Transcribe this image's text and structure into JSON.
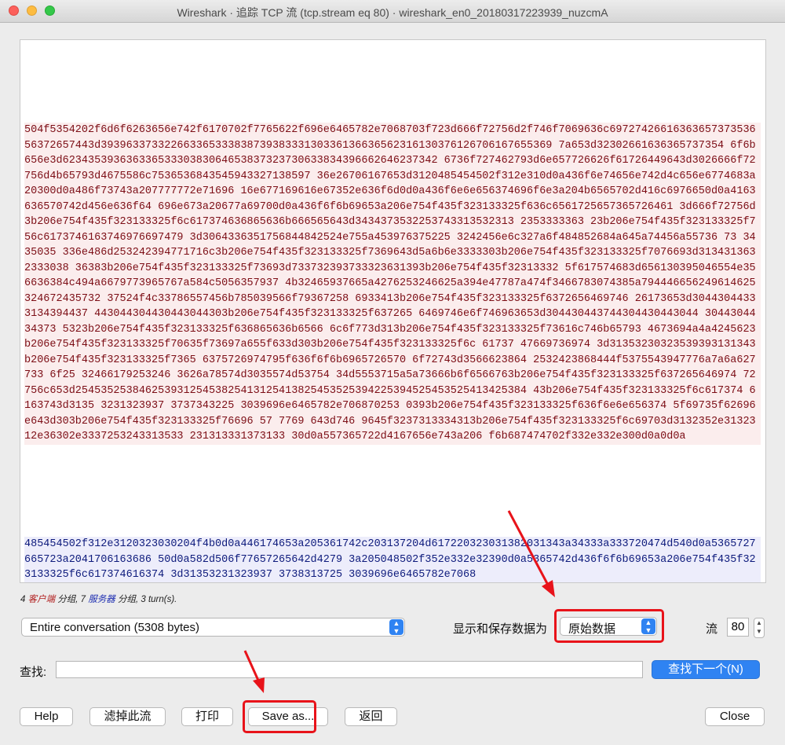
{
  "window": {
    "title": "Wireshark · 追踪 TCP 流 (tcp.stream eq 80) · wireshark_en0_20180317223939_nuzcmA"
  },
  "stream": {
    "client_text": "504f5354202f6d6f6263656e742f6170702f7765622f696e6465782e7068703f723d666f72756d2f746f7069636c6972742661636365737353656372657443d39396337332266336533383873938333130336136636562316130376126706167655369 7a653d32302661636365737354 6f6b656e3d62343539363633653330383064653837323730633834396662646237342 6736f727462793d6e657726626f61726449643d3026666f72756d4b65793d4675586c7536536843545943327138597 36e26706167653d3120485454502f312e310d0a436f6e74656e742d4c656e6774683a20300d0a486f73743a207777772e71696 16e677169616e67352e636f6d0d0a436f6e6e656374696f6e3a204b6565702d416c6976650d0a4163636570742d456e636f64 696e673a20677a69700d0a436f6f6b69653a206e754f435f323133325f636c6561725657365726461 3d666f72756d3b206e754f435f323133325f6c617374636865636b666565643d3434373532253743313532313 2353333363 23b206e754f435f323133325f756c6173746163746976697479 3d3064336351756844842524e755a453976375225 3242456e6c327a6f484852684a645a74456a55736 73 3435035 336e486d253242394771716c3b206e754f435f323133325f7369643d5a6b6e3333303b206e754f435f323133325f7076693d3134313632333038 36383b206e754f435f323133325f73693d733732393733323631393b206e754f435f32313332 5f617574683d656130395046554e356636384c494a6679773965767a584c5056357937 4b32465937665a4276253246625a394e47787a474f3466783074385a794446656249614625324672435732 37524f4c33786557456b785039566f79367258 6933413b206e754f435f323133325f6372656469746 26173653d30443044333134394437 443044304430443044303b206e754f435f323133325f637265 6469746e6f746963653d304430443744304430443044 3044304434373 5323b206e754f435f323133325f636865636b6566 6c6f773d313b206e754f435f323133325f73616c746b65793 4673694a4a4245623b206e754f435f323133325f70635f73697a655f633d303b206e754f435f323133325f6c 61737 47669736974 3d31353230323539393131343b206e754f435f323133325f7365 6375726974795f636f6f6b6965726570 6f72743d3566623864 2532423868444f5375543947776a7a6a627733 6f25 32466179253246 3626a78574d3035574d53754 34d5553715a5a73666b6f6566763b206e754f435f323133325f637265646974 72756c653d25453525384625393125453825413125413825453525394225394525453525413425384 43b206e754f435f323133325f6c617374 6163743d3135 3231323937 3737343225 3039696e6465782e706870253 0393b206e754f435f323133325f636f6e6e656374 5f69735f62696e643d303b206e754f435f323133325f76696 57 7769 643d746 9645f3237313334313b206e754f435f323133325f6c69703d3132352e3132312e36302e3337253243313533 231313331373133 30d0a557365722d4167656e743a206 f6b687474702f332e332e300d0a0d0a",
    "server_text": "485454502f312e3120323030204f4b0d0a446174653a205361742c203137204d617220323031382031343a34333a333720474d540d0a5365727665723a2041706163686 50d0a582d506f77657265642d4279 3a205048502f352e332e32390d0a5365742d436f6f6b69653a206e754f435f323133325f6c617374616374 3d31353231323937 3738313725 3039696e6465782e7068"
  },
  "summary": {
    "prefix": "4 ",
    "client_label": "客户端",
    "mid1": " 分组, 7 ",
    "server_label": "服务器",
    "mid2": " 分组, 3 turn(s)."
  },
  "controls": {
    "conversation_select": "Entire conversation (5308 bytes)",
    "show_save_label": "显示和保存数据为",
    "format_select": "原始数据",
    "stream_label": "流",
    "stream_number": "80",
    "find_label": "查找:",
    "find_value": "",
    "find_next_button": "查找下一个(N)"
  },
  "buttons": {
    "help": "Help",
    "filter_out": "滤掉此流",
    "print": "打印",
    "save_as": "Save as...",
    "back": "返回",
    "close": "Close"
  },
  "colors": {
    "client_text": "#7c0d15",
    "client_bg": "#fbeded",
    "server_text": "#0d1a7c",
    "server_bg": "#ededfb",
    "accent": "#2f83f2",
    "highlight": "#e8131a"
  }
}
